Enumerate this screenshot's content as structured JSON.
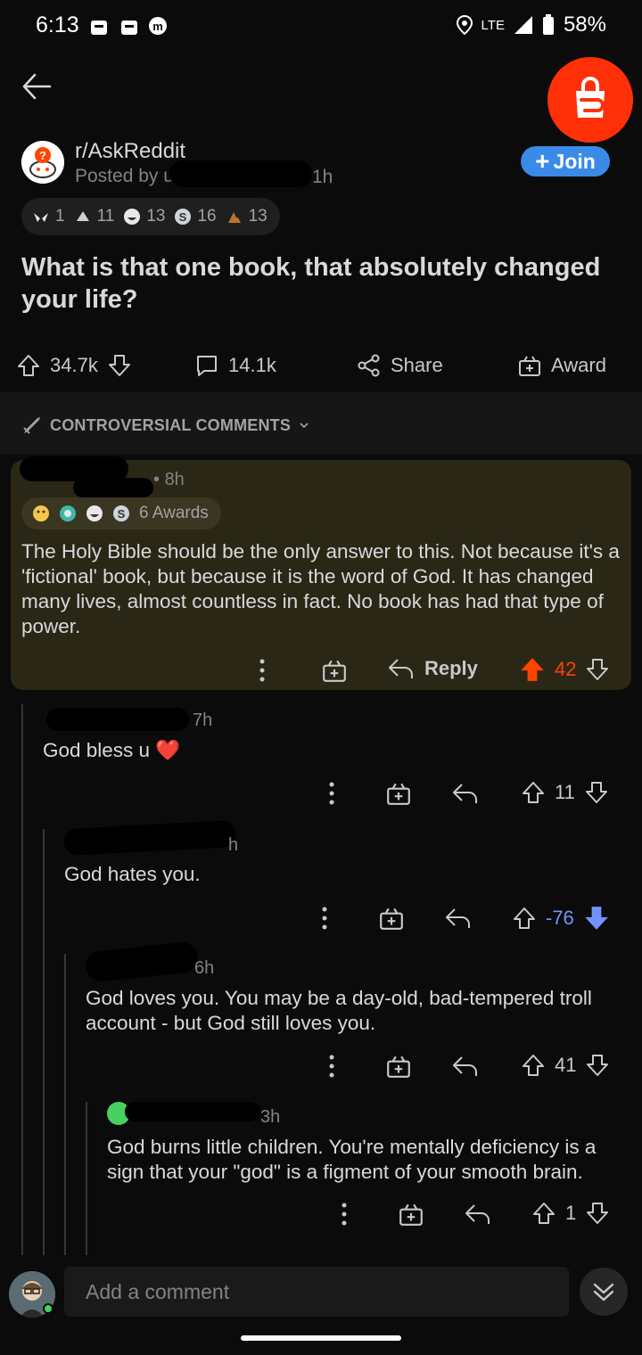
{
  "status": {
    "time": "6:13",
    "network": "LTE",
    "battery": "58%"
  },
  "post": {
    "subreddit": "r/AskReddit",
    "posted_prefix": "Posted by u",
    "age": "1h",
    "join_label": "Join",
    "awards": [
      {
        "icon": "wings-award-icon",
        "count": "1"
      },
      {
        "icon": "hands-award-icon",
        "count": "11"
      },
      {
        "icon": "laugh-award-icon",
        "count": "13"
      },
      {
        "icon": "silver-award-icon",
        "count": "16"
      },
      {
        "icon": "poop-award-icon",
        "count": "13"
      }
    ],
    "title": "What is that one book, that absolutely changed your life?",
    "upvotes": "34.7k",
    "comments": "14.1k",
    "share_label": "Share",
    "award_label": "Award"
  },
  "sort_label": "CONTROVERSIAL COMMENTS",
  "comments": [
    {
      "age": "8h",
      "awards_label": "6 Awards",
      "body": "The Holy Bible should be the only answer to this. Not because it's a 'fictional' book, but because it is the word of God. It has changed many lives, almost countless in fact. No book has had that type of power.",
      "reply_label": "Reply",
      "score": "42"
    },
    {
      "age": "7h",
      "body": "God bless u ❤️",
      "score": "11"
    },
    {
      "age": "h",
      "body": "God hates you.",
      "score": "-76"
    },
    {
      "age": "6h",
      "body": "God loves you. You may be a day-old, bad-tempered troll account - but God still loves you.",
      "score": "41"
    },
    {
      "age": "3h",
      "body": "God burns little children. You're mentally deficiency is a sign that your \"god\" is a figment of your smooth brain.",
      "score": "1"
    }
  ],
  "composer": {
    "placeholder": "Add a comment"
  },
  "colors": {
    "upvote": "#ff4500",
    "downvote": "#7193ff",
    "join": "#3a8be8",
    "highlight": "#2a2716"
  }
}
